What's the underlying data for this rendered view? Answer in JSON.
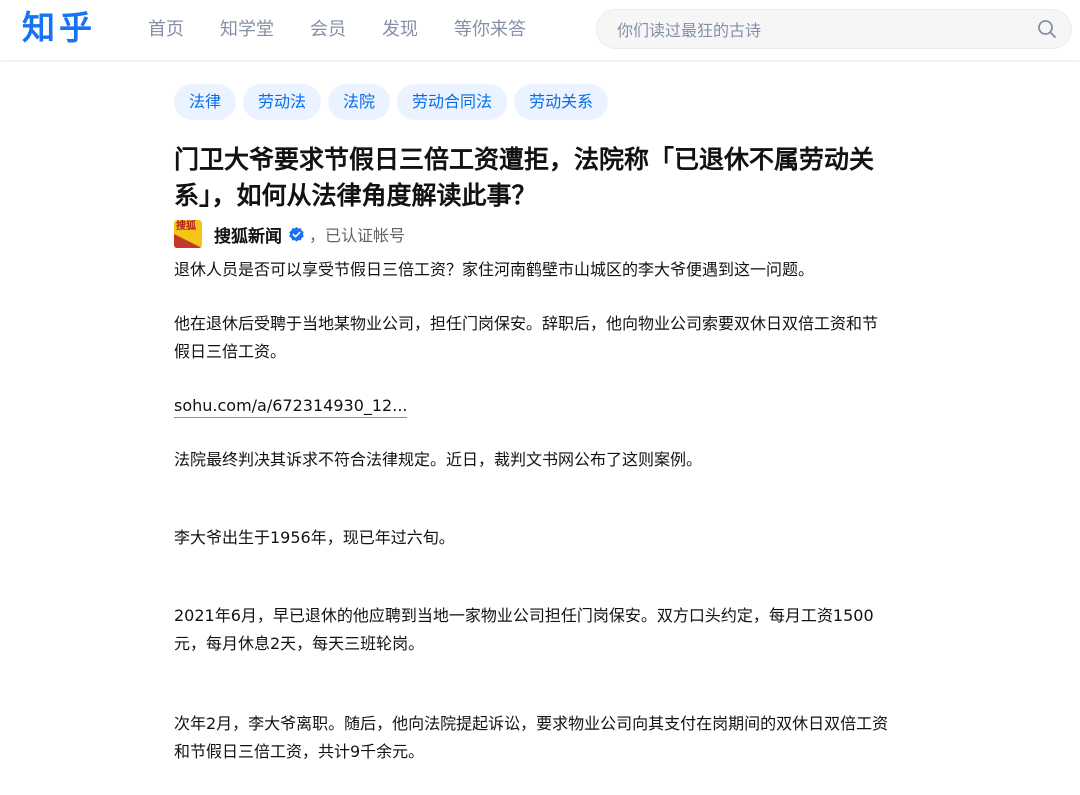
{
  "header": {
    "logo": "知乎",
    "nav": [
      "首页",
      "知学堂",
      "会员",
      "发现",
      "等你来答"
    ],
    "search_placeholder": "你们读过最狂的古诗"
  },
  "question": {
    "tags": [
      "法律",
      "劳动法",
      "法院",
      "劳动合同法",
      "劳动关系"
    ],
    "title_line1": "门卫大爷要求节假日三倍工资遭拒，法院称「已退休不属劳动关",
    "title_line2": "系」，如何从法律角度解读此事？"
  },
  "author": {
    "avatar_text": "搜狐",
    "name": "搜狐新闻",
    "badge_icon": "verified-badge-icon",
    "description": "，已认证帐号"
  },
  "answer": {
    "p1": "退休人员是否可以享受节假日三倍工资？家住河南鹤壁市山城区的李大爷便遇到这一问题。",
    "p2_line1": "他在退休后受聘于当地某物业公司，担任门岗保安。辞职后，他向物业公司索要双休日双倍工资和节",
    "p2_line2": "假日三倍工资。",
    "link": "sohu.com/a/672314930_12...",
    "p3": "法院最终判决其诉求不符合法律规定。近日，裁判文书网公布了这则案例。",
    "p4": "李大爷出生于1956年，现已年过六旬。",
    "p5_line1": "2021年6月，早已退休的他应聘到当地一家物业公司担任门岗保安。双方口头约定，每月工资1500",
    "p5_line2": "元，每月休息2天，每天三班轮岗。",
    "p6_line1": "次年2月，李大爷离职。随后，他向法院提起诉讼，要求物业公司向其支付在岗期间的双休日双倍工资",
    "p6_line2": "和节假日三倍工资，共计9千余元。"
  },
  "colors": {
    "brand": "#1772f6",
    "tag_bg": "#eaf3ff",
    "tag_text": "#056de8",
    "nav_text": "#8590a6"
  }
}
